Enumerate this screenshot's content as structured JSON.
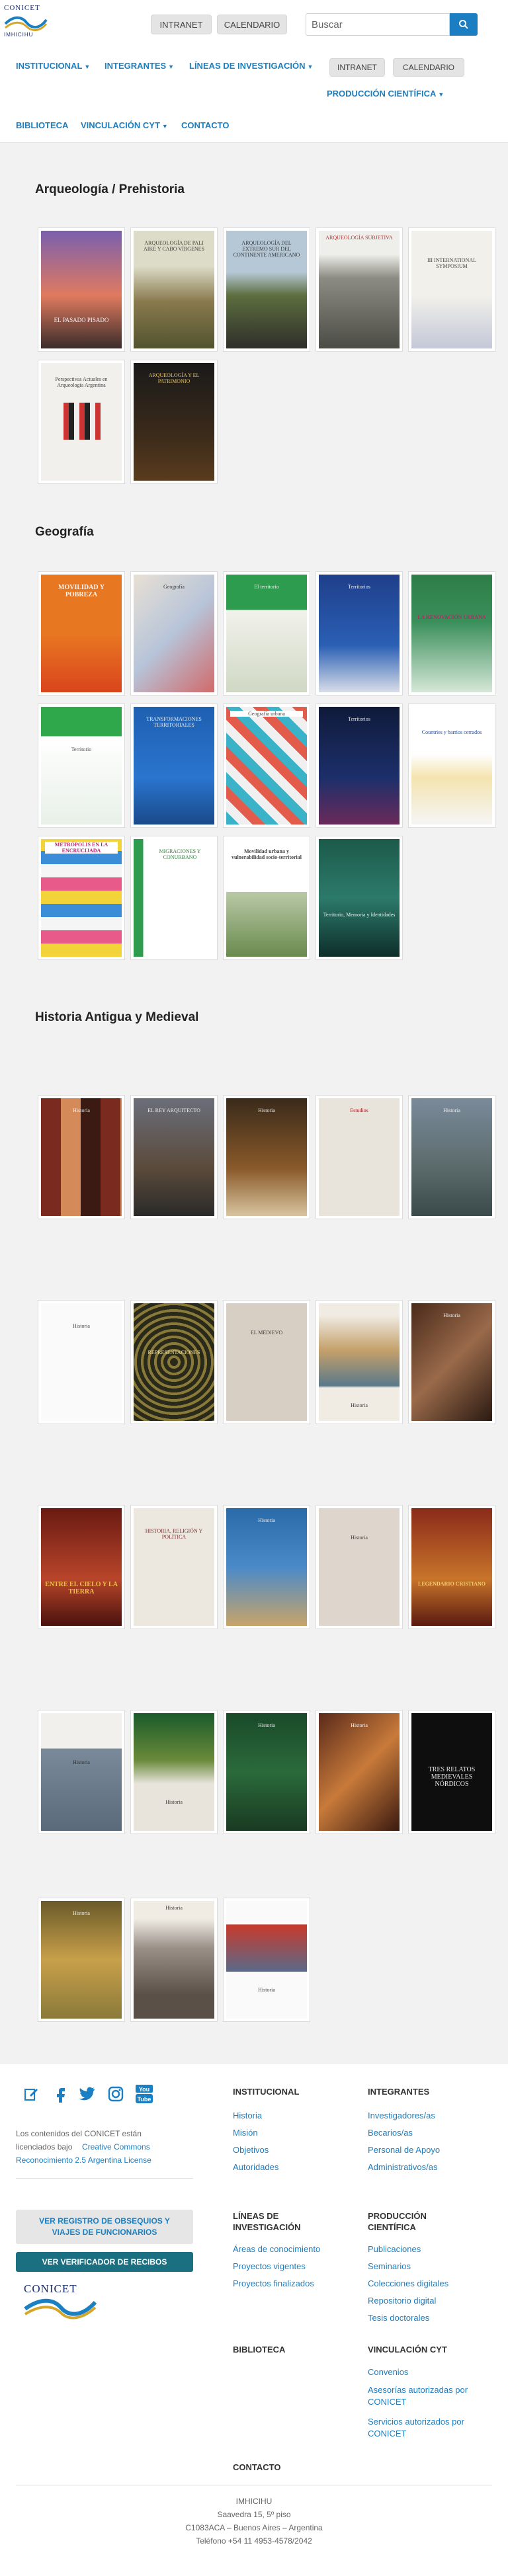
{
  "header": {
    "logo_text": "CONICET",
    "logo_sub": "IMHICIHU",
    "intranet": "INTRANET",
    "calendario": "CALENDARIO",
    "search_placeholder": "Buscar"
  },
  "nav": {
    "institucional": "INSTITUCIONAL",
    "integrantes": "INTEGRANTES",
    "lineas": "LÍNEAS DE INVESTIGACIÓN",
    "intranet": "INTRANET",
    "calendario": "CALENDARIO",
    "produccion": "PRODUCCIÓN CIENTÍFICA",
    "biblioteca": "BIBLIOTECA",
    "vinculacion": "VINCULACIÓN CYT",
    "contacto": "CONTACTO"
  },
  "sections": {
    "arqueologia": "Arqueología / Prehistoria",
    "geografia": "Geografía",
    "historia": "Historia Antigua y Medieval"
  },
  "books": {
    "a1": "EL PASADO PISADO",
    "a2": "ARQUEOLOGÍA DE PALI AIKE Y CABO VÍRGENES",
    "a3": "ARQUEOLOGÍA DEL EXTREMO SUR DEL CONTINENTE AMERICANO",
    "a4": "ARQUEOLOGÍA SUBJETIVA",
    "a5": "III INTERNATIONAL SYMPOSIUM",
    "a6": "Perspectivas Actuales en Arqueología Argentina",
    "a7": "ARQUEOLOGÍA Y EL PATRIMONIO",
    "g1": "MOVILIDAD Y POBREZA",
    "g2": "Geografía",
    "g3": "El territorio",
    "g4": "Territorios",
    "g5": "LA RENOVACIÓN URBANA",
    "g6": "Territorio",
    "g7": "TRANSFORMACIONES TERRITORIALES",
    "g8": "Geografía urbana",
    "g9": "Territorios",
    "g10": "Countries y barrios cerrados",
    "g11": "METRÓPOLIS EN LA ENCRUCIJADA",
    "g12": "MIGRACIONES Y CONURBANO",
    "g13": "Movilidad urbana y vulnerabilidad socio-territorial",
    "g14": "Territorio, Memoria y Identidades",
    "h1": "Historia",
    "h2": "EL REY ARQUITECTO",
    "h3": "Historia",
    "h4": "Estudios",
    "h5": "Historia",
    "h6": "Historia",
    "h7": "REPRESENTACIONES",
    "h8": "EL MEDIEVO",
    "h9": "Historia",
    "h10": "Historia",
    "h11": "ENTRE EL CIELO Y LA TIERRA",
    "h12": "HISTORIA, RELIGIÓN Y POLÍTICA",
    "h13": "Historia",
    "h14": "Historia",
    "h15": "LEGENDARIO CRISTIANO",
    "h16": "Historia",
    "h17": "Historia",
    "h18": "Historia",
    "h19": "Historia",
    "h20": "TRES RELATOS MEDIEVALES NÓRDICOS",
    "h21": "Historia",
    "h22": "Historia",
    "h23": "Historia"
  },
  "footer": {
    "license_text_1": "Los contenidos del CONICET están",
    "license_text_2": "licenciados bajo",
    "license_link_1": "Creative Commons",
    "license_link_2": "Reconocimiento 2.5 Argentina License",
    "btn_registro": "VER REGISTRO DE OBSEQUIOS Y VIAJES DE FUNCIONARIOS",
    "btn_verificador": "VER VERIFICADOR DE RECIBOS",
    "logo_text": "CONICET",
    "institucional": "INSTITUCIONAL",
    "historia": "Historia",
    "mision": "Misión",
    "objetivos": "Objetivos",
    "autoridades": "Autoridades",
    "integrantes": "INTEGRANTES",
    "investigadores": "Investigadores/as",
    "becarios": "Becarios/as",
    "personal": "Personal de Apoyo",
    "administrativos": "Administrativos/as",
    "lineas": "LÍNEAS DE INVESTIGACIÓN",
    "areas": "Áreas de conocimiento",
    "proyectos_vigentes": "Proyectos vigentes",
    "proyectos_finalizados": "Proyectos finalizados",
    "produccion": "PRODUCCIÓN CIENTÍFICA",
    "publicaciones": "Publicaciones",
    "seminarios": "Seminarios",
    "colecciones": "Colecciones digitales",
    "repositorio": "Repositorio digital",
    "tesis": "Tesis doctorales",
    "biblioteca": "BIBLIOTECA",
    "vinculacion": "VINCULACIÓN CYT",
    "convenios": "Convenios",
    "asesorias": "Asesorías autorizadas por CONICET",
    "servicios": "Servicios autorizados por CONICET",
    "contacto": "CONTACTO",
    "addr_name": "IMHICIHU",
    "addr_1": "Saavedra 15, 5º piso",
    "addr_2": "C1083ACA – Buenos Aires – Argentina",
    "addr_3": "Teléfono +54 11 4953-4578/2042"
  }
}
